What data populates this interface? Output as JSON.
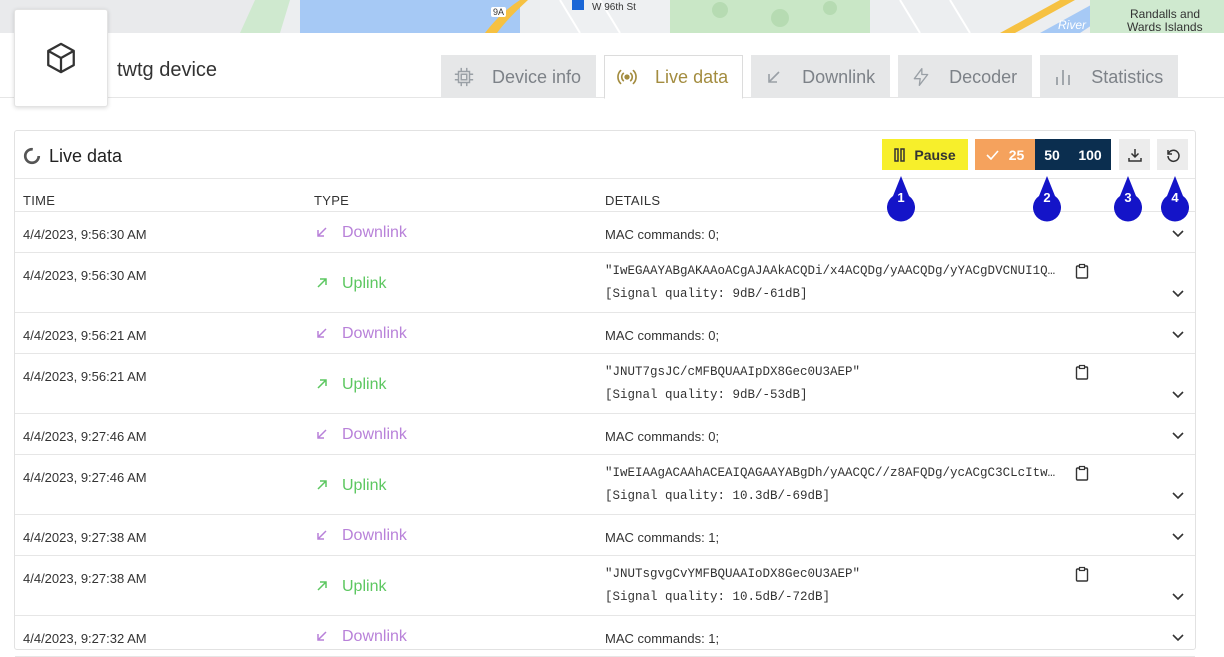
{
  "map": {
    "labels": [
      "W 96th St",
      "Randalls and",
      "Wards Islands",
      "River",
      "9A"
    ]
  },
  "header": {
    "device_icon": "cube-icon",
    "device_name": "twtg device",
    "tabs": [
      {
        "label": "Device info",
        "icon": "chip-icon",
        "active": false
      },
      {
        "label": "Live data",
        "icon": "broadcast-icon",
        "active": true
      },
      {
        "label": "Downlink",
        "icon": "arrow-down-left-icon",
        "active": false
      },
      {
        "label": "Decoder",
        "icon": "lightning-icon",
        "active": false
      },
      {
        "label": "Statistics",
        "icon": "bar-chart-icon",
        "active": false
      }
    ]
  },
  "live": {
    "title": "Live data",
    "pause_label": "Pause",
    "page_sizes": [
      "25",
      "50",
      "100"
    ],
    "selected_page_size": "25"
  },
  "table": {
    "columns": [
      "TIME",
      "TYPE",
      "DETAILS"
    ],
    "rows": [
      {
        "time": "4/4/2023, 9:56:30 AM",
        "type": "Downlink",
        "details": "MAC commands: 0;"
      },
      {
        "time": "4/4/2023, 9:56:30 AM",
        "type": "Uplink",
        "payload": "\"IwEGAAYABgAKAAoACgAJAAkACQDi/x4ACQDg/yAACQDg/yYACgDVCNUI1Q…",
        "signal": "[Signal quality: 9dB/-61dB]"
      },
      {
        "time": "4/4/2023, 9:56:21 AM",
        "type": "Downlink",
        "details": "MAC commands: 0;"
      },
      {
        "time": "4/4/2023, 9:56:21 AM",
        "type": "Uplink",
        "payload": "\"JNUT7gsJC/cMFBQUAAIpDX8Gec0U3AEP\"",
        "signal": "[Signal quality: 9dB/-53dB]"
      },
      {
        "time": "4/4/2023, 9:27:46 AM",
        "type": "Downlink",
        "details": "MAC commands: 0;"
      },
      {
        "time": "4/4/2023, 9:27:46 AM",
        "type": "Uplink",
        "payload": "\"IwEIAAgACAAhACEAIQAGAAYABgDh/yAACQC//z8AFQDg/ycACgC3CLcItw…",
        "signal": "[Signal quality: 10.3dB/-69dB]"
      },
      {
        "time": "4/4/2023, 9:27:38 AM",
        "type": "Downlink",
        "details": "MAC commands: 1;"
      },
      {
        "time": "4/4/2023, 9:27:38 AM",
        "type": "Uplink",
        "payload": "\"JNUTsgvgCvYMFBQUAAIoDX8Gec0U3AEP\"",
        "signal": "[Signal quality: 10.5dB/-72dB]"
      },
      {
        "time": "4/4/2023, 9:27:32 AM",
        "type": "Downlink",
        "details": "MAC commands: 1;"
      }
    ]
  },
  "markers": [
    "1",
    "2",
    "3",
    "4"
  ],
  "colors": {
    "pause_bg": "#f7ef2b",
    "selected_size_bg": "#f5a25d",
    "size_bg": "#0b2e4f",
    "active_tab_text": "#a38c3f",
    "downlink": "#b881d9",
    "uplink": "#5cc760",
    "marker": "#1414c8"
  }
}
